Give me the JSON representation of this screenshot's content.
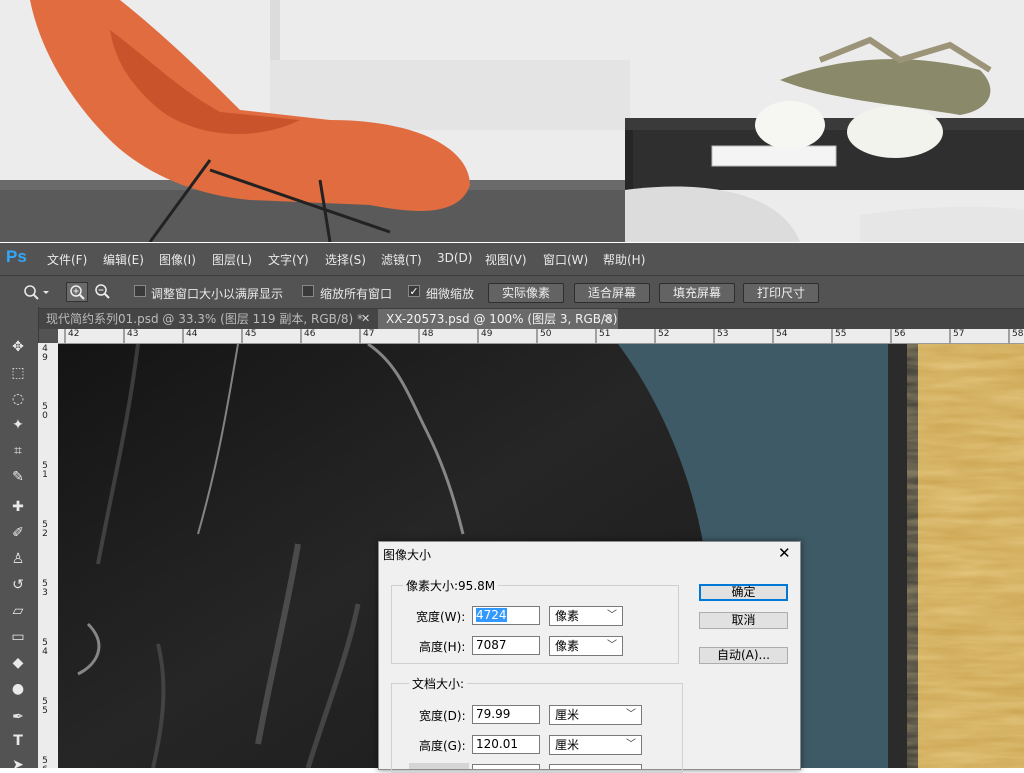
{
  "app": {
    "logo": "Ps",
    "menu": [
      "文件(F)",
      "编辑(E)",
      "图像(I)",
      "图层(L)",
      "文字(Y)",
      "选择(S)",
      "滤镜(T)",
      "3D(D)",
      "视图(V)",
      "窗口(W)",
      "帮助(H)"
    ]
  },
  "options": {
    "resize_label": "调整窗口大小以满屏显示",
    "resize_checked": false,
    "zoom_all_label": "缩放所有窗口",
    "zoom_all_checked": false,
    "scrubby_label": "细微缩放",
    "scrubby_checked": true,
    "buttons": [
      "实际像素",
      "适合屏幕",
      "填充屏幕",
      "打印尺寸"
    ]
  },
  "tabs": [
    {
      "title": "现代简约系列01.psd @ 33.3% (图层 119 副本, RGB/8) *",
      "active": false
    },
    {
      "title": "XX-20573.psd @ 100% (图层 3, RGB/8)",
      "active": true
    }
  ],
  "ruler": {
    "horizontal": [
      "42",
      "43",
      "44",
      "45",
      "46",
      "47",
      "48",
      "49",
      "50",
      "51",
      "52",
      "53",
      "54",
      "55",
      "56",
      "57",
      "58"
    ],
    "vertical": [
      "4\n9",
      "5\n0",
      "5\n1",
      "5\n2",
      "5\n3",
      "5\n4",
      "5\n5",
      "5\n6"
    ]
  },
  "tools": [
    "move-icon",
    "marquee-icon",
    "lasso-icon",
    "magic-wand-icon",
    "crop-icon",
    "eyedropper-icon",
    "healing-icon",
    "brush-icon",
    "stamp-icon",
    "history-brush-icon",
    "eraser-icon",
    "gradient-icon",
    "blur-icon",
    "dodge-icon",
    "pen-icon",
    "type-icon",
    "path-select-icon"
  ],
  "dialog": {
    "title": "图像大小",
    "pixel_dims_label": "像素大小:95.8M",
    "width_label": "宽度(W):",
    "width_value": "4724",
    "width_unit": "像素",
    "height_label": "高度(H):",
    "height_value": "7087",
    "height_unit": "像素",
    "doc_size_label": "文档大小:",
    "doc_width_label": "宽度(D):",
    "doc_width_value": "79.99",
    "doc_width_unit": "厘米",
    "doc_height_label": "高度(G):",
    "doc_height_value": "120.01",
    "doc_height_unit": "厘米",
    "ok": "确定",
    "cancel": "取消",
    "auto": "自动(A)..."
  },
  "colors": {
    "ps_panel": "#535353",
    "ps_blue": "#31a8ff",
    "canvas_teal": "#3d5a66",
    "gold_texture": "#c9a24e",
    "chair_orange": "#e06c3f"
  }
}
